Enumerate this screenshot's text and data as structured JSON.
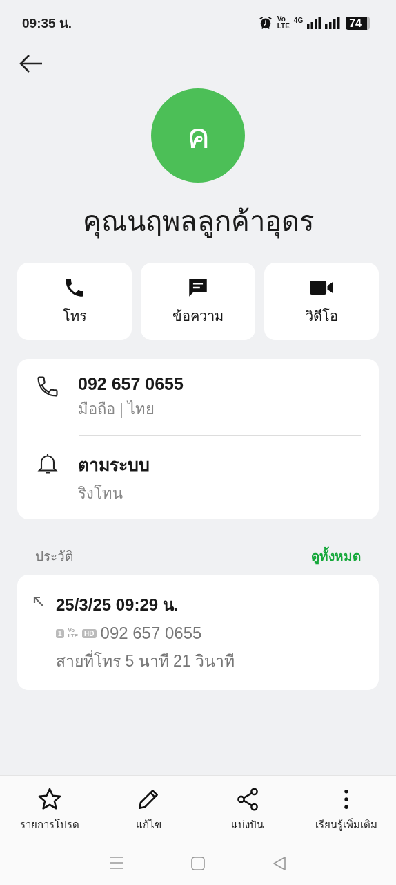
{
  "status_bar": {
    "time": "09:35 น.",
    "volte_top": "Vo",
    "volte_bottom": "LTE",
    "network": "4G",
    "battery": "74"
  },
  "contact": {
    "initial": "ค",
    "name": "คุณนฤพลลูกค้าอุดร"
  },
  "actions": [
    {
      "kind": "call",
      "label": "โทร"
    },
    {
      "kind": "message",
      "label": "ข้อความ"
    },
    {
      "kind": "video",
      "label": "วิดีโอ"
    }
  ],
  "details": [
    {
      "kind": "phone",
      "title": "092 657 0655",
      "subtitle": "มือถือ  |  ไทย"
    },
    {
      "kind": "ringtone",
      "title": "ตามระบบ",
      "subtitle": "ริงโทน"
    }
  ],
  "history": {
    "heading": "ประวัติ",
    "see_all": "ดูทั้งหมด",
    "entries": [
      {
        "kind": "outgoing",
        "datetime": "25/3/25 09:29 น.",
        "sim": "1",
        "volte_top": "Vo",
        "volte_bottom": "LTE",
        "hd": "HD",
        "number": "092 657 0655",
        "duration": "สายที่โทร  5 นาที 21 วินาที"
      }
    ]
  },
  "bottom_actions": [
    {
      "kind": "star",
      "label": "รายการโปรด"
    },
    {
      "kind": "edit",
      "label": "แก้ไข"
    },
    {
      "kind": "share",
      "label": "แบ่งปัน"
    },
    {
      "kind": "more",
      "label": "เรียนรู้เพิ่มเติม"
    }
  ]
}
